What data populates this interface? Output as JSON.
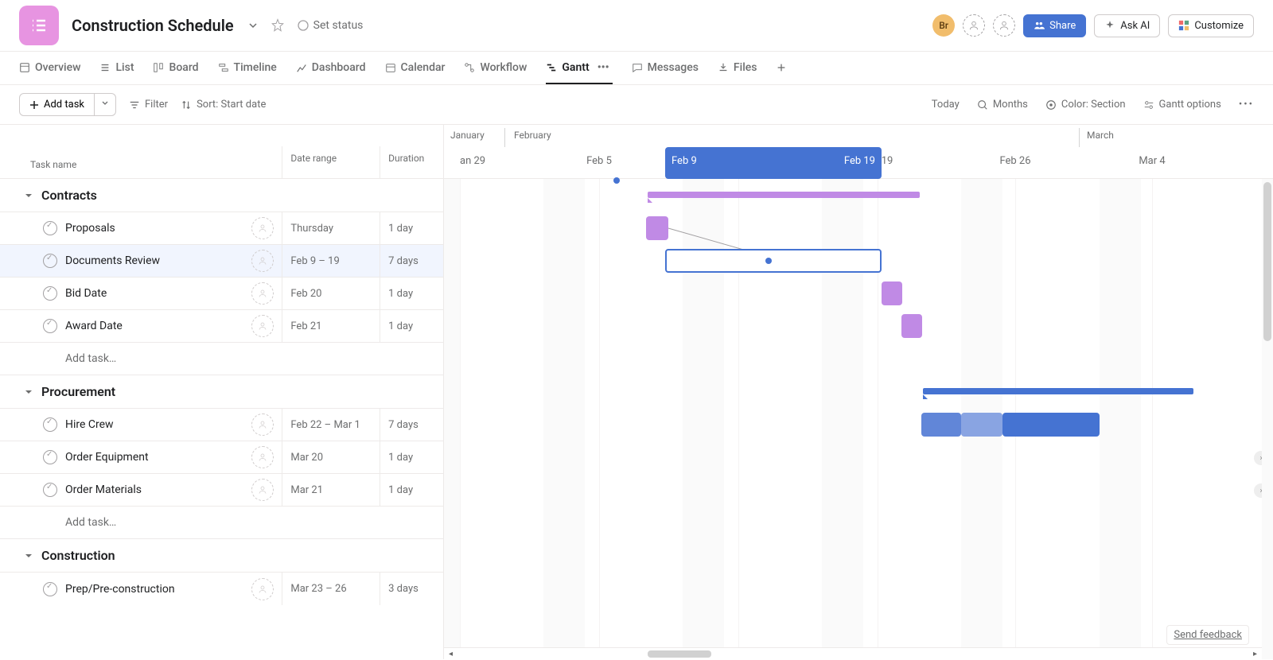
{
  "header": {
    "title": "Construction Schedule",
    "set_status": "Set status",
    "avatar_initials": "Br",
    "share": "Share",
    "ask_ai": "Ask AI",
    "customize": "Customize"
  },
  "tabs": {
    "overview": "Overview",
    "list": "List",
    "board": "Board",
    "timeline": "Timeline",
    "dashboard": "Dashboard",
    "calendar": "Calendar",
    "workflow": "Workflow",
    "gantt": "Gantt",
    "messages": "Messages",
    "files": "Files"
  },
  "toolbar": {
    "add_task": "Add task",
    "filter": "Filter",
    "sort": "Sort: Start date",
    "today": "Today",
    "months": "Months",
    "color": "Color: Section",
    "gantt_options": "Gantt options"
  },
  "columns": {
    "name": "Task name",
    "date_range": "Date range",
    "duration": "Duration"
  },
  "timeline": {
    "months": {
      "january": "January",
      "february": "February",
      "march": "March"
    },
    "dates": {
      "jan29": "an 29",
      "feb5": "Feb 5",
      "feb9": "Feb 9",
      "feb19": "Feb 19",
      "feb19b": "19",
      "feb26": "Feb 26",
      "mar4": "Mar 4"
    }
  },
  "sections": [
    {
      "name": "Contracts",
      "tasks": [
        {
          "name": "Proposals",
          "date": "Thursday",
          "duration": "1 day"
        },
        {
          "name": "Documents Review",
          "date": "Feb 9 – 19",
          "duration": "7 days",
          "selected": true
        },
        {
          "name": "Bid Date",
          "date": "Feb 20",
          "duration": "1 day"
        },
        {
          "name": "Award Date",
          "date": "Feb 21",
          "duration": "1 day"
        }
      ],
      "add_task": "Add task…"
    },
    {
      "name": "Procurement",
      "tasks": [
        {
          "name": "Hire Crew",
          "date": "Feb 22 – Mar 1",
          "duration": "7 days"
        },
        {
          "name": "Order Equipment",
          "date": "Mar 20",
          "duration": "1 day"
        },
        {
          "name": "Order Materials",
          "date": "Mar 21",
          "duration": "1 day"
        }
      ],
      "add_task": "Add task…"
    },
    {
      "name": "Construction",
      "tasks": [
        {
          "name": "Prep/Pre-construction",
          "date": "Mar 23 – 26",
          "duration": "3 days"
        }
      ]
    }
  ],
  "footer": {
    "send_feedback": "Send feedback"
  }
}
